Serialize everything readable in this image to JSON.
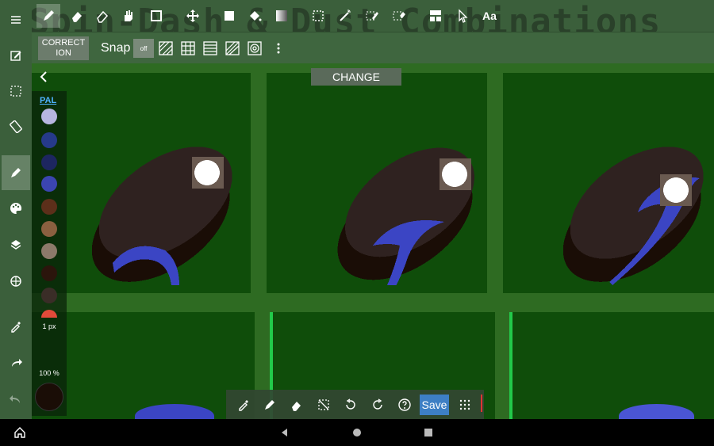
{
  "document": {
    "title": "Spin-Dash & Dust Combinations"
  },
  "top_toolbar": {
    "tools": [
      {
        "name": "menu-icon"
      },
      {
        "name": "pencil-icon",
        "active": true
      },
      {
        "name": "eraser-icon"
      },
      {
        "name": "soft-eraser-icon"
      },
      {
        "name": "hand-icon"
      },
      {
        "name": "rectangle-icon"
      },
      {
        "name": "move-icon"
      },
      {
        "name": "fill-rectangle-icon"
      },
      {
        "name": "bucket-icon"
      },
      {
        "name": "gradient-icon"
      },
      {
        "name": "select-rect-icon"
      },
      {
        "name": "magic-wand-icon"
      },
      {
        "name": "select-pen-icon"
      },
      {
        "name": "select-eraser-icon"
      },
      {
        "name": "layer-comp-icon"
      },
      {
        "name": "pointer-icon"
      },
      {
        "name": "text-icon"
      }
    ],
    "text_tool_label": "Aa"
  },
  "second_toolbar": {
    "correction_label": "CORRECT ION",
    "snap_label": "Snap",
    "snap_off_label": "off",
    "snap_modes": [
      "parallel-lines",
      "grid",
      "horizontal-lines",
      "perspective",
      "concentric"
    ]
  },
  "sidebar": {
    "items": [
      {
        "name": "menu-icon"
      },
      {
        "name": "edit-icon"
      },
      {
        "name": "selection-icon"
      },
      {
        "name": "transform-icon"
      },
      {
        "name": "brush-icon",
        "active": true
      },
      {
        "name": "palette-icon"
      },
      {
        "name": "layers-icon"
      },
      {
        "name": "reference-icon"
      },
      {
        "name": "eyedropper-icon"
      },
      {
        "name": "redo-icon"
      },
      {
        "name": "undo-icon"
      }
    ]
  },
  "canvas": {
    "change_label": "CHANGE"
  },
  "palette": {
    "title": "PAL",
    "colors": [
      "#b7b6e0",
      "#263a8a",
      "#1d2660",
      "#3b45b0",
      "#5c2f1a",
      "#8a6040",
      "#8c7a6a",
      "#2b150c",
      "#3a2d27",
      "#e24a3a"
    ],
    "brush_size": "1 px",
    "opacity": "100 %",
    "current_color": "#1a0d06"
  },
  "bottom_toolbar": {
    "tools": [
      "eyedropper-icon",
      "pencil-icon",
      "eraser-icon",
      "deselect-icon",
      "rotate-left-icon",
      "rotate-right-icon",
      "help-icon"
    ],
    "save_label": "Save",
    "grid_menu": "dots-grid-icon"
  },
  "colors": {
    "toolbar_bg": "#3b5f3b",
    "canvas_bg": "#2e6b22",
    "tile_bg": "#0f4d0a",
    "sprite_body": "#2f2220",
    "sprite_shadow": "#1a0d06",
    "sprite_accent": "#3b45c4",
    "save_button": "#3d7fc4"
  }
}
